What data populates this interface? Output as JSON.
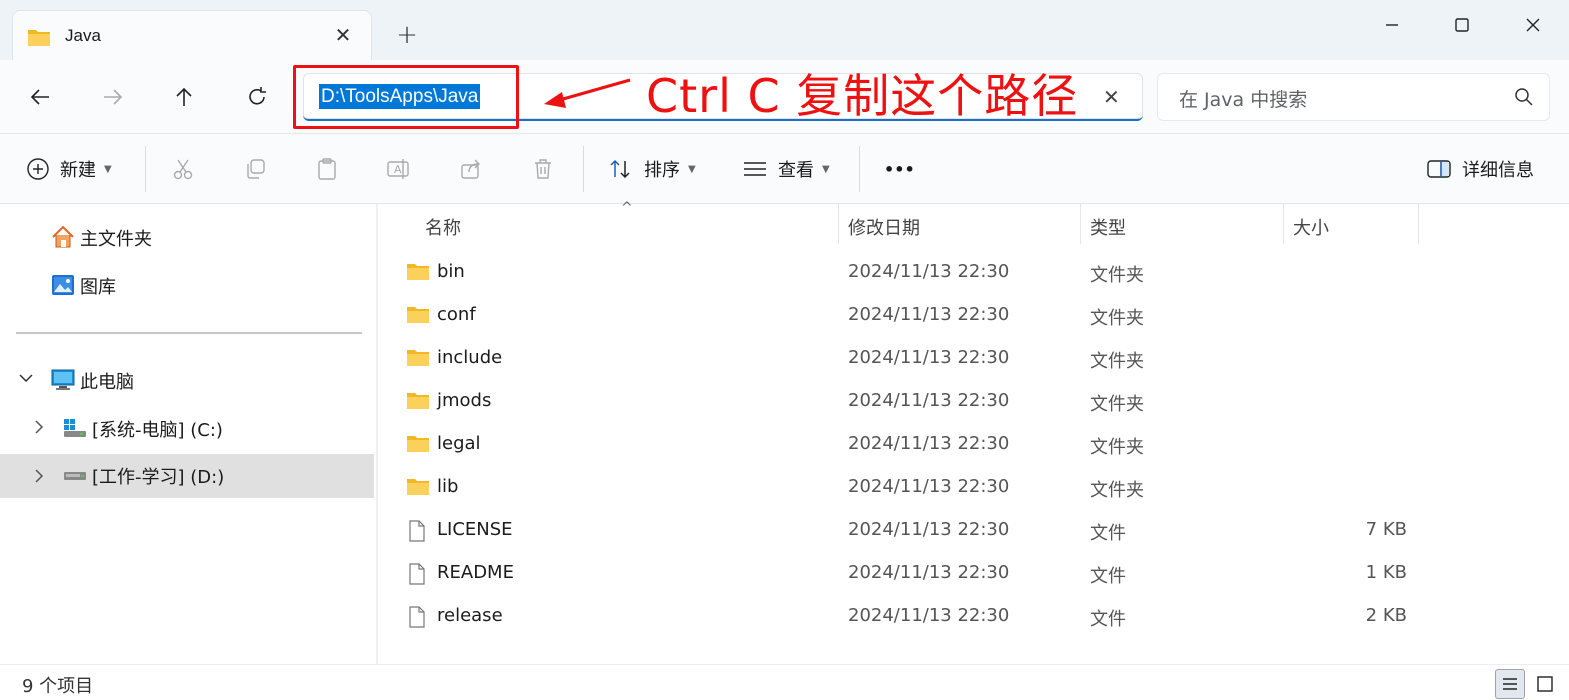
{
  "tab": {
    "title": "Java",
    "folder_icon": "folder-icon"
  },
  "window_controls": {
    "minimize": "minimize-icon",
    "maximize": "maximize-icon",
    "close": "close-icon"
  },
  "address_bar": {
    "path": "D:\\ToolsApps\\Java"
  },
  "annotation": {
    "text": "Ctrl C 复制这个路径",
    "color": "#ee1111"
  },
  "search": {
    "placeholder": "在 Java 中搜索"
  },
  "toolbar": {
    "new_label": "新建",
    "sort_label": "排序",
    "view_label": "查看",
    "more_label": "•••",
    "details_label": "详细信息"
  },
  "sidebar": {
    "home": "主文件夹",
    "gallery": "图库",
    "this_pc": "此电脑",
    "drive_c": "[系统-电脑] (C:)",
    "drive_d": "[工作-学习] (D:)"
  },
  "columns": {
    "name": "名称",
    "modified": "修改日期",
    "type": "类型",
    "size": "大小"
  },
  "files": [
    {
      "name": "bin",
      "modified": "2024/11/13 22:30",
      "type": "文件夹",
      "size": "",
      "kind": "folder"
    },
    {
      "name": "conf",
      "modified": "2024/11/13 22:30",
      "type": "文件夹",
      "size": "",
      "kind": "folder"
    },
    {
      "name": "include",
      "modified": "2024/11/13 22:30",
      "type": "文件夹",
      "size": "",
      "kind": "folder"
    },
    {
      "name": "jmods",
      "modified": "2024/11/13 22:30",
      "type": "文件夹",
      "size": "",
      "kind": "folder"
    },
    {
      "name": "legal",
      "modified": "2024/11/13 22:30",
      "type": "文件夹",
      "size": "",
      "kind": "folder"
    },
    {
      "name": "lib",
      "modified": "2024/11/13 22:30",
      "type": "文件夹",
      "size": "",
      "kind": "folder"
    },
    {
      "name": "LICENSE",
      "modified": "2024/11/13 22:30",
      "type": "文件",
      "size": "7 KB",
      "kind": "file"
    },
    {
      "name": "README",
      "modified": "2024/11/13 22:30",
      "type": "文件",
      "size": "1 KB",
      "kind": "file"
    },
    {
      "name": "release",
      "modified": "2024/11/13 22:30",
      "type": "文件",
      "size": "2 KB",
      "kind": "file"
    }
  ],
  "status": {
    "count_text": "9 个项目"
  },
  "colors": {
    "accent": "#0078d7",
    "folder": "#f7c948",
    "selected_row": "#e0e0e0"
  }
}
